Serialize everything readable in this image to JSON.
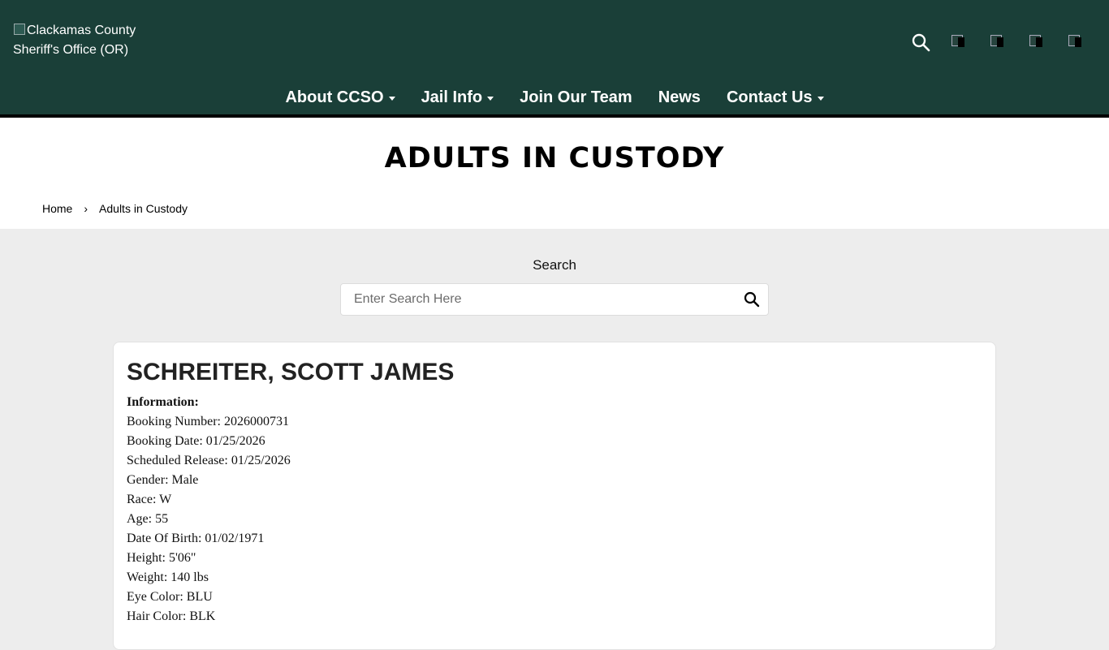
{
  "header": {
    "logo_alt": "Clackamas County Sheriff's Office (OR)",
    "search_icon": "search-icon",
    "social_icons": [
      "facebook-icon",
      "twitter-icon",
      "instagram-icon",
      "youtube-icon"
    ]
  },
  "nav": {
    "items": [
      {
        "label": "About CCSO",
        "has_dropdown": true
      },
      {
        "label": "Jail Info",
        "has_dropdown": true
      },
      {
        "label": "Join Our Team",
        "has_dropdown": false
      },
      {
        "label": "News",
        "has_dropdown": false
      },
      {
        "label": "Contact Us",
        "has_dropdown": true
      }
    ]
  },
  "page": {
    "title": "ADULTS IN CUSTODY",
    "breadcrumb": {
      "home": "Home",
      "separator": "›",
      "current": "Adults in Custody"
    }
  },
  "search": {
    "label": "Search",
    "placeholder": "Enter Search Here"
  },
  "inmate": {
    "name": "SCHREITER, SCOTT JAMES",
    "info_heading": "Information:",
    "fields": [
      "Booking Number: 2026000731",
      "Booking Date: 01/25/2026",
      "Scheduled Release: 01/25/2026",
      "Gender: Male",
      "Race: W",
      "Age: 55",
      "Date Of Birth: 01/02/1971",
      "Height: 5'06\"",
      "Weight: 140 lbs",
      "Eye Color: BLU",
      "Hair Color: BLK"
    ]
  },
  "colors": {
    "header_bg": "#1a3f38",
    "page_bg": "#ededed",
    "card_bg": "#ffffff"
  }
}
